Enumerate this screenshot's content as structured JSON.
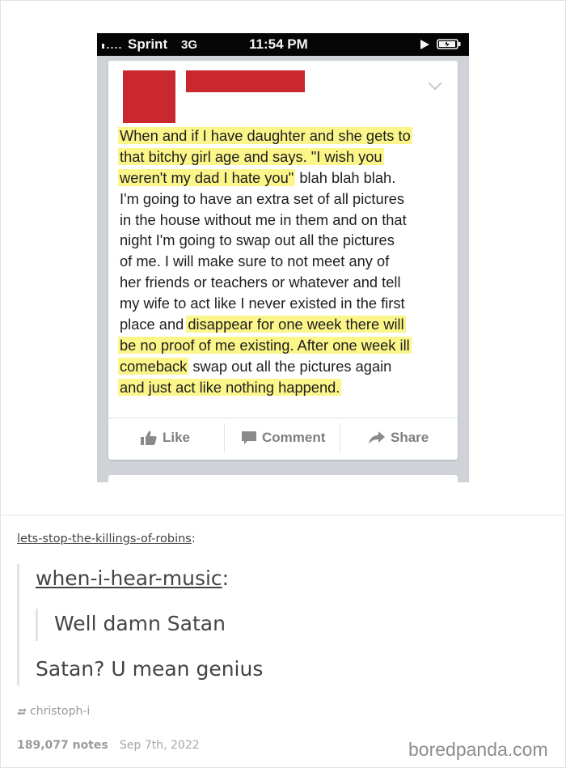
{
  "phone": {
    "status_bar": {
      "carrier": "Sprint",
      "network": "3G",
      "time": "11:54 PM"
    },
    "post_lines": [
      {
        "pre": "",
        "hl": "When and if I have daughter and she gets to",
        "post": ""
      },
      {
        "pre": "",
        "hl": "that bitchy girl age and says. \"I wish you",
        "post": ""
      },
      {
        "pre": "",
        "hl": "weren't my dad I hate you\"",
        "post": " blah blah blah."
      },
      {
        "pre": "I'm going to have an extra set of all pictures",
        "hl": "",
        "post": ""
      },
      {
        "pre": "in the house without me in them and on that",
        "hl": "",
        "post": ""
      },
      {
        "pre": "night I'm going to swap out all the pictures",
        "hl": "",
        "post": ""
      },
      {
        "pre": "of me. I will make sure to not meet any of",
        "hl": "",
        "post": ""
      },
      {
        "pre": "her friends or teachers or whatever and tell",
        "hl": "",
        "post": ""
      },
      {
        "pre": "my wife to act like I never existed in the first",
        "hl": "",
        "post": ""
      },
      {
        "pre": "place and ",
        "hl": "disappear for one week there will",
        "post": ""
      },
      {
        "pre": "",
        "hl": "be no proof of me existing. After one week ill",
        "post": ""
      },
      {
        "pre": "",
        "hl": "comeback",
        "post": " swap out all the pictures again"
      },
      {
        "pre": "",
        "hl": "and just act like nothing happend.",
        "post": ""
      }
    ],
    "actions": {
      "like": "Like",
      "comment": "Comment",
      "share": "Share"
    },
    "highlight_color": "#fbf58a",
    "redaction_color": "#c8282e"
  },
  "thread": {
    "reblogger_1": "lets-stop-the-killings-of-robins",
    "reblogger_2": "when-i-hear-music",
    "colon": ":",
    "quote_text": "Well damn Satan",
    "reply_text": "Satan? U mean genius",
    "via_user": "christoph-i",
    "notes": "189,077 notes",
    "date": "Sep 7th, 2022"
  },
  "watermark": "boredpanda.com",
  "icons": [
    "signal-icon",
    "play-icon",
    "battery-icon",
    "chevron-down-icon",
    "like-icon",
    "comment-icon",
    "share-icon",
    "reblog-icon"
  ]
}
